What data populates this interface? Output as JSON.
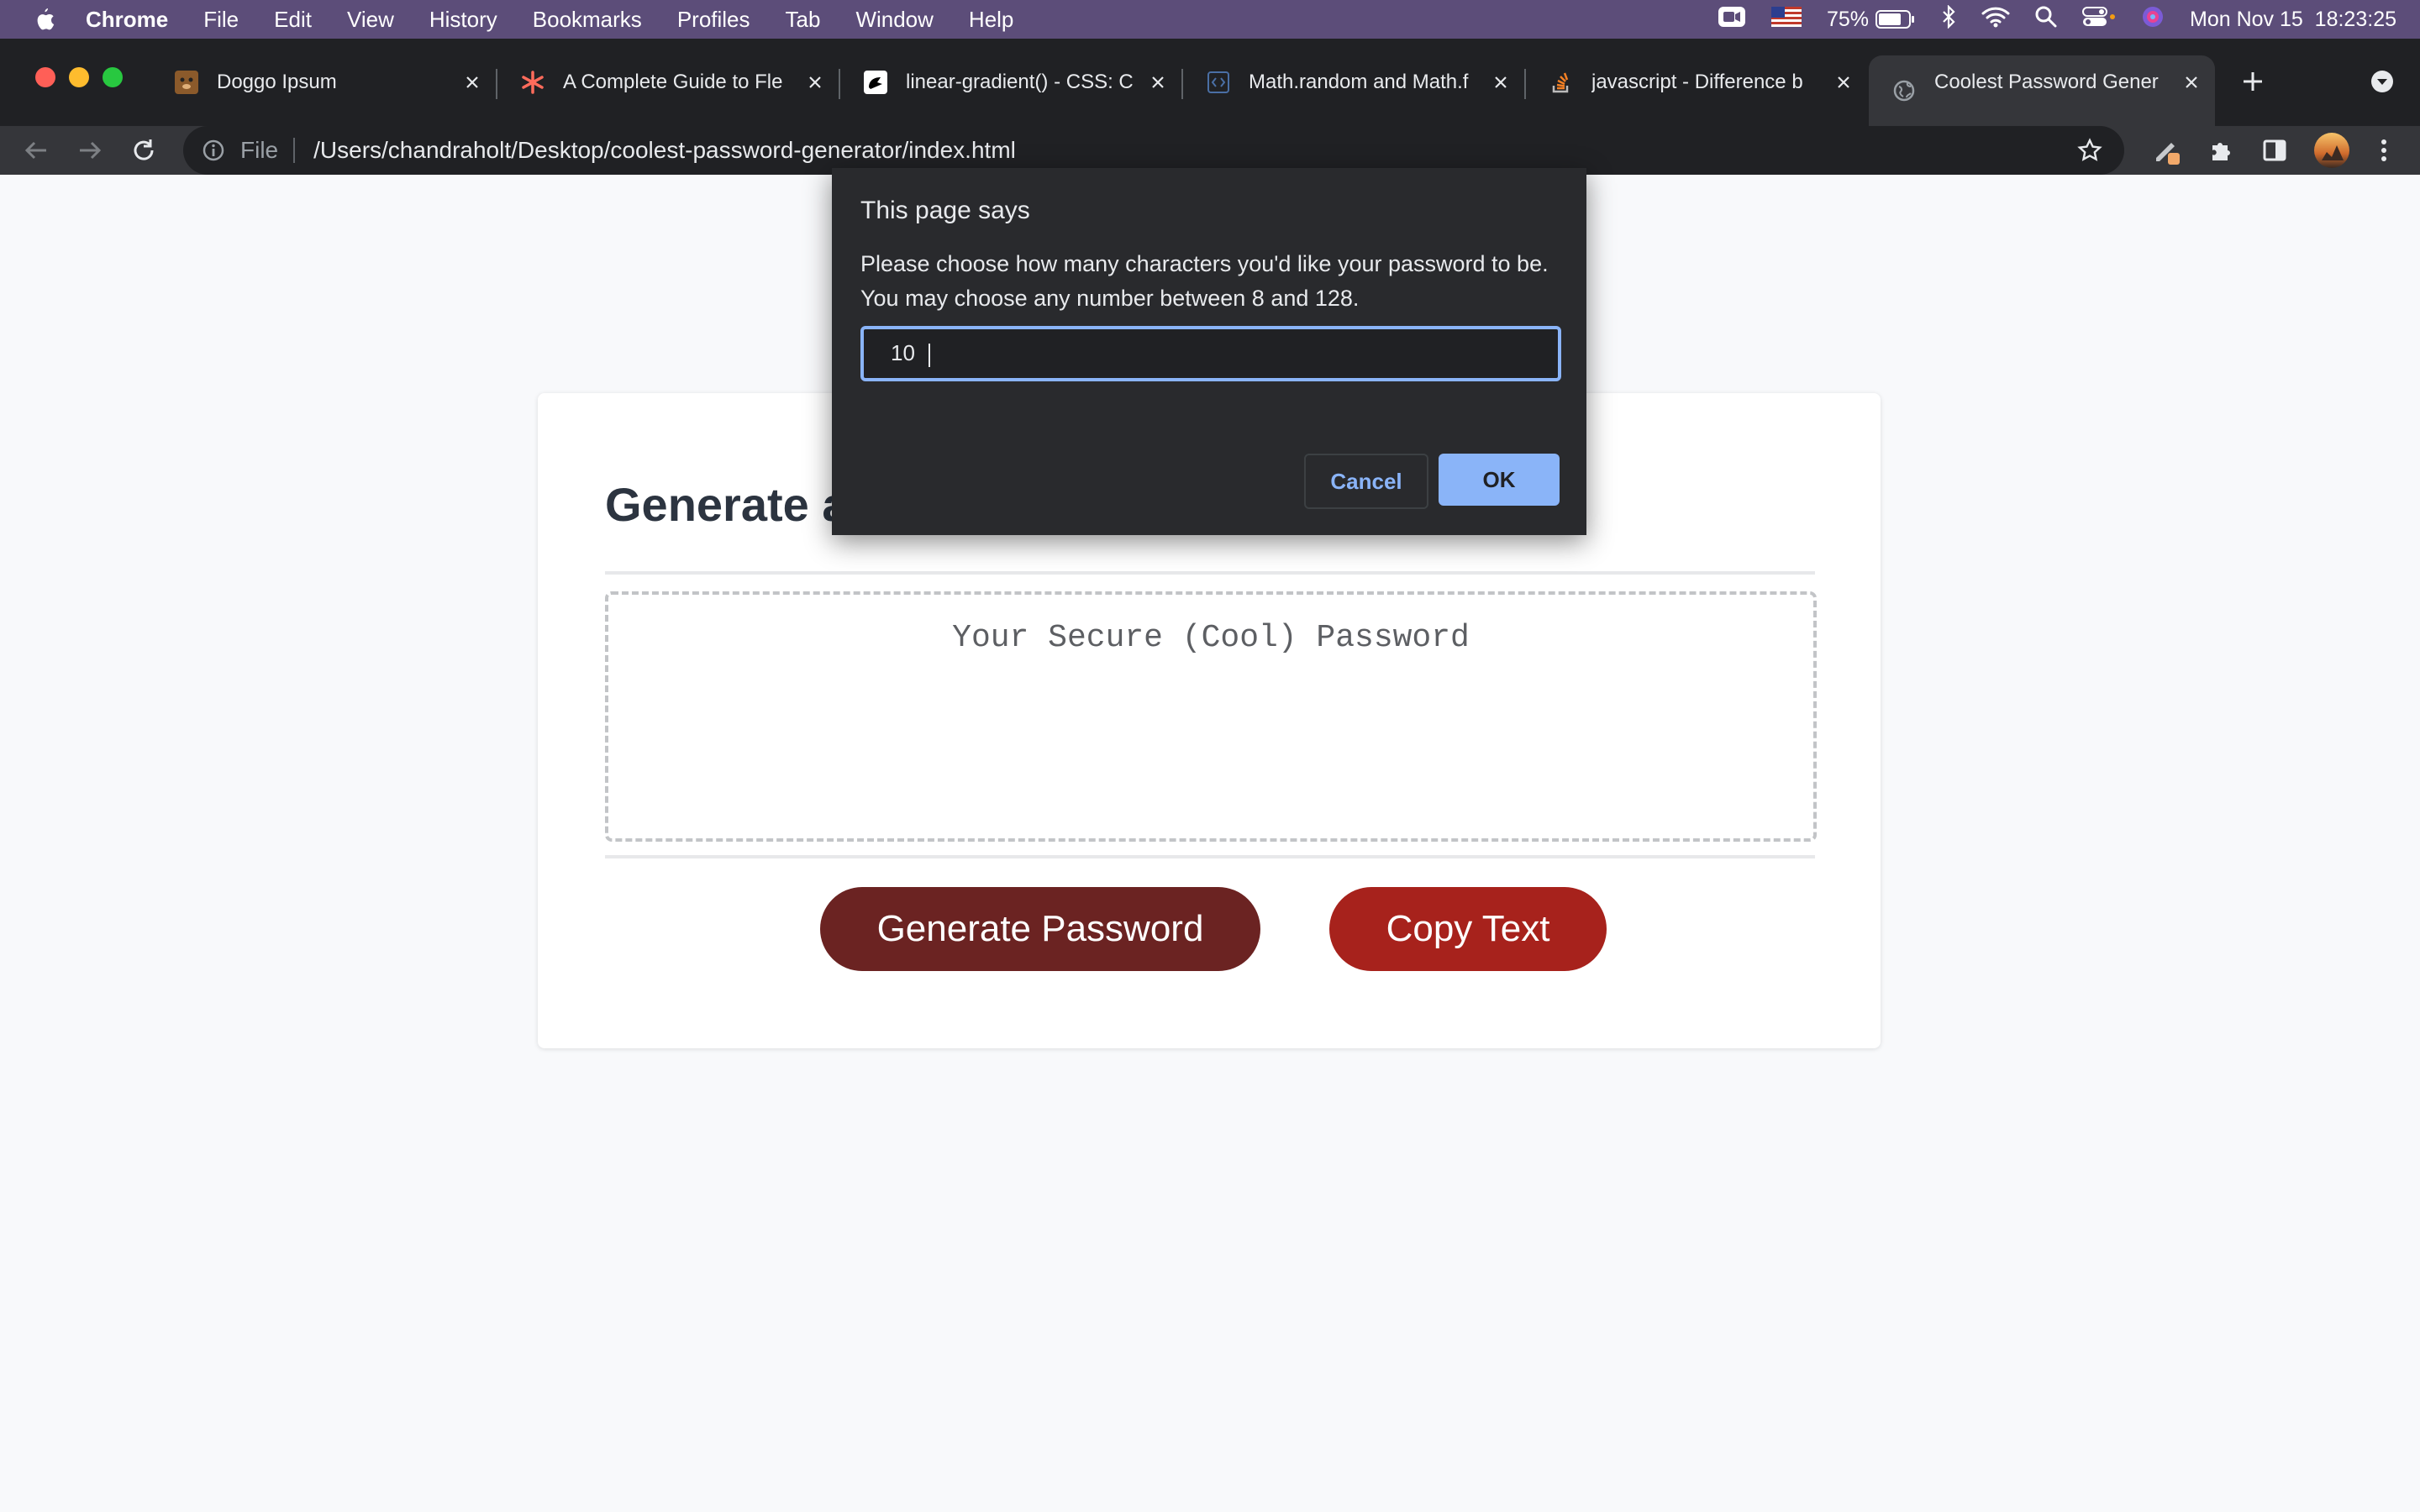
{
  "menubar": {
    "items": [
      "Chrome",
      "File",
      "Edit",
      "View",
      "History",
      "Bookmarks",
      "Profiles",
      "Tab",
      "Window",
      "Help"
    ],
    "battery": "75%",
    "datetime": "Mon Nov 15  18:23:25"
  },
  "tabs": [
    {
      "title": "Doggo Ipsum"
    },
    {
      "title": "A Complete Guide to Fle"
    },
    {
      "title": "linear-gradient() - CSS: C"
    },
    {
      "title": "Math.random and Math.f"
    },
    {
      "title": "javascript - Difference b"
    },
    {
      "title": "Coolest Password Gener"
    }
  ],
  "omnibox": {
    "scheme_label": "File",
    "url": "/Users/chandraholt/Desktop/coolest-password-generator/index.html"
  },
  "page": {
    "heading": "Generate a",
    "password_placeholder": "Your Secure (Cool) Password",
    "generate_label": "Generate Password",
    "copy_label": "Copy Text"
  },
  "dialog": {
    "title": "This page says",
    "message": "Please choose how many characters you'd like your password to be. You may choose any number between 8 and 128.",
    "input_value": "10",
    "cancel_label": "Cancel",
    "ok_label": "OK"
  },
  "colors": {
    "menubar": "#5c4d79",
    "generate_button": "#6b2322",
    "copy_button": "#a7221c",
    "dialog_accent": "#8ab4f8"
  }
}
